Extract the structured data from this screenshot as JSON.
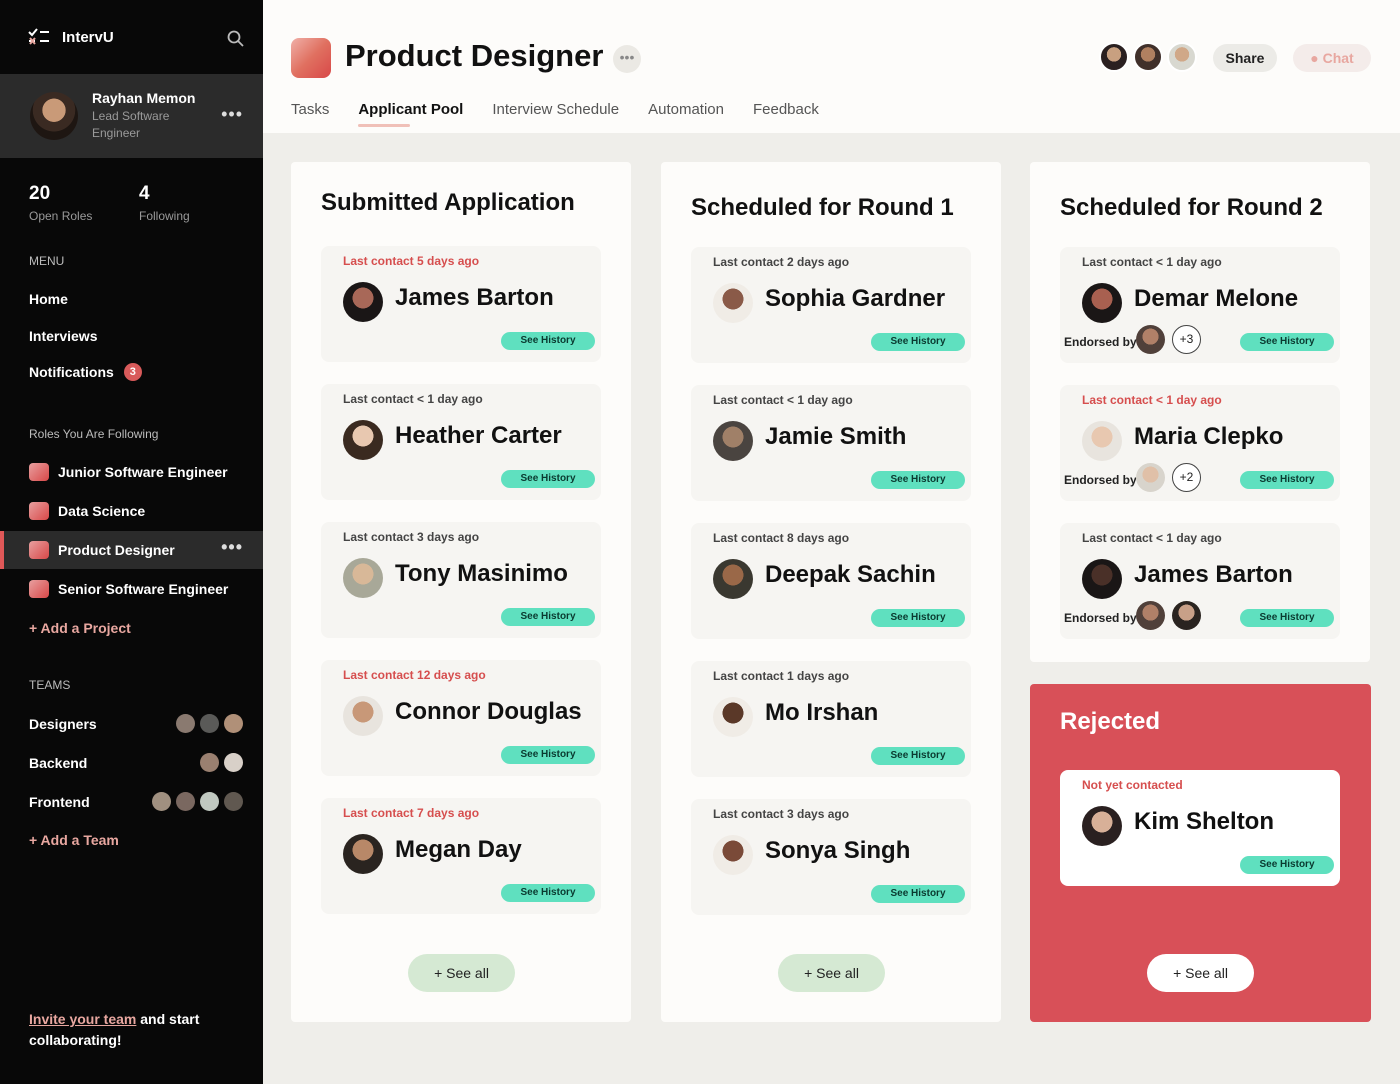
{
  "app": {
    "name": "IntervU"
  },
  "user": {
    "name": "Rayhan Memon",
    "role": "Lead Software Engineer"
  },
  "stats": [
    {
      "value": "20",
      "label": "Open Roles"
    },
    {
      "value": "4",
      "label": "Following"
    }
  ],
  "menu": {
    "title": "MENU",
    "items": [
      {
        "label": "Home"
      },
      {
        "label": "Interviews"
      },
      {
        "label": "Notifications",
        "badge": "3"
      }
    ]
  },
  "roles": {
    "title": "Roles You Are Following",
    "items": [
      "Junior Software Engineer",
      "Data Science",
      "Product Designer",
      "Senior Software Engineer"
    ],
    "add_label": "+ Add a Project"
  },
  "teams": {
    "title": "TEAMS",
    "items": [
      "Designers",
      "Backend",
      "Frontend"
    ],
    "add_label": "+ Add a Team"
  },
  "invite": {
    "link": "Invite your team",
    "rest": " and start collaborating!"
  },
  "header": {
    "title": "Product Designer",
    "more": "•••",
    "share": "Share",
    "chat": "Chat",
    "tabs": [
      "Tasks",
      "Applicant Pool",
      "Interview Schedule",
      "Automation",
      "Feedback"
    ],
    "active_tab": "Applicant Pool"
  },
  "columns": [
    {
      "title": "Submitted Application",
      "see_all": "+ See all",
      "cards": [
        {
          "contact": "Last contact 5 days ago",
          "name": "James Barton",
          "recent": false
        },
        {
          "contact": "Last contact < 1 day ago",
          "name": "Heather Carter",
          "recent": true
        },
        {
          "contact": "Last contact 3 days ago",
          "name": "Tony Masinimo",
          "recent": true
        },
        {
          "contact": "Last contact 12 days ago",
          "name": "Connor Douglas",
          "recent": false
        },
        {
          "contact": "Last contact 7 days ago",
          "name": "Megan Day",
          "recent": false
        }
      ]
    },
    {
      "title": "Scheduled for Round 1",
      "see_all": "+ See all",
      "cards": [
        {
          "contact": "Last contact 2 days ago",
          "name": "Sophia Gardner",
          "recent": true
        },
        {
          "contact": "Last contact < 1 day ago",
          "name": "Jamie Smith",
          "recent": true
        },
        {
          "contact": "Last contact 8 days ago",
          "name": "Deepak Sachin",
          "recent": true
        },
        {
          "contact": "Last contact 1 days ago",
          "name": "Mo Irshan",
          "recent": true
        },
        {
          "contact": "Last contact 3 days ago",
          "name": "Sonya Singh",
          "recent": true
        }
      ]
    },
    {
      "title": "Scheduled for Round 2",
      "cards": [
        {
          "contact": "Last contact < 1 day ago",
          "name": "Demar Melone",
          "recent": true,
          "endorsed_more": "+3"
        },
        {
          "contact": "Last contact < 1 day ago",
          "name": "Maria Clepko",
          "recent": false,
          "endorsed_more": "+2"
        },
        {
          "contact": "Last contact < 1 day ago",
          "name": "James Barton",
          "recent": true,
          "endorsed_more": ""
        }
      ]
    }
  ],
  "rejected": {
    "title": "Rejected",
    "see_all": "+ See all",
    "card": {
      "contact": "Not yet contacted",
      "name": "Kim Shelton"
    }
  },
  "labels": {
    "see_history": "See History",
    "endorsed_by": "Endorsed by"
  },
  "colors": {
    "accent_red": "#d85058",
    "history_green": "#5fe0bf",
    "see_all_green": "#d5e9d3",
    "sidebar": "#080808",
    "stale_contact": "#d64e4e"
  }
}
